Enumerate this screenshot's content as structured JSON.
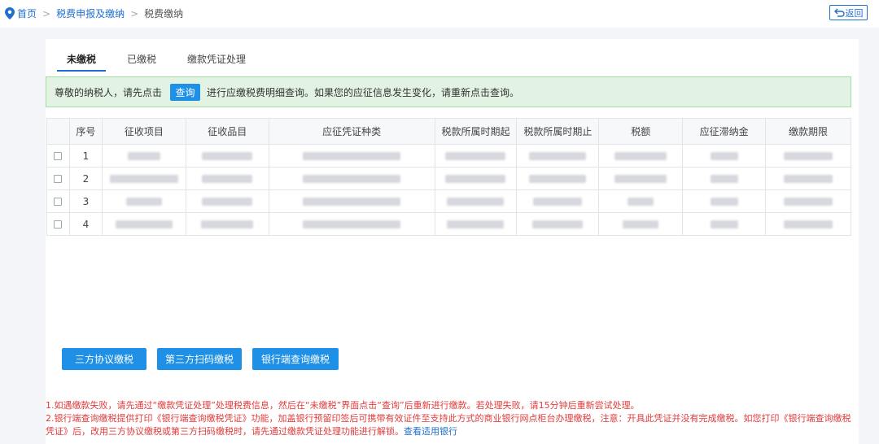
{
  "breadcrumb": {
    "home": "首页",
    "level2": "税费申报及缴纳",
    "current": "税费缴纳"
  },
  "back_label": "返回",
  "tabs": [
    {
      "label": "未缴税",
      "active": true
    },
    {
      "label": "已缴税",
      "active": false
    },
    {
      "label": "缴款凭证处理",
      "active": false
    }
  ],
  "notice": {
    "before": "尊敬的纳税人，请先点击",
    "button": "查询",
    "after": "进行应缴税费明细查询。如果您的应征信息发生变化，请重新点击查询。"
  },
  "table": {
    "headers": [
      "",
      "序号",
      "征收项目",
      "征收品目",
      "应征凭证种类",
      "税款所属时期起",
      "税款所属时期止",
      "税额",
      "应征滞纳金",
      "缴款期限"
    ],
    "rows": [
      {
        "no": "1"
      },
      {
        "no": "2"
      },
      {
        "no": "3"
      },
      {
        "no": "4"
      }
    ]
  },
  "actions": [
    "三方协议缴税",
    "第三方扫码缴税",
    "银行端查询缴税"
  ],
  "notes": {
    "line1": "1.如遇缴款失败，请先通过“缴款凭证处理”处理税费信息，然后在“未缴税”界面点击“查询”后重新进行缴款。若处理失败，请15分钟后重新尝试处理。",
    "line2": "2.银行端查询缴税提供打印《银行端查询缴税凭证》功能，加盖银行预留印签后可携带有效证件至支持此方式的商业银行网点柜台办理缴税，注意：开具此凭证并没有完成缴税。如您打印《银行端查询缴税凭证》后，改用三方协议缴税或第三方扫码缴税时，请先通过缴款凭证处理功能进行解锁。",
    "link": "查看适用银行"
  },
  "colors": {
    "primary": "#1e90e6",
    "link": "#1f6fd1",
    "notice_bg": "#e3f3e3",
    "warning_text": "#e23a3a"
  }
}
